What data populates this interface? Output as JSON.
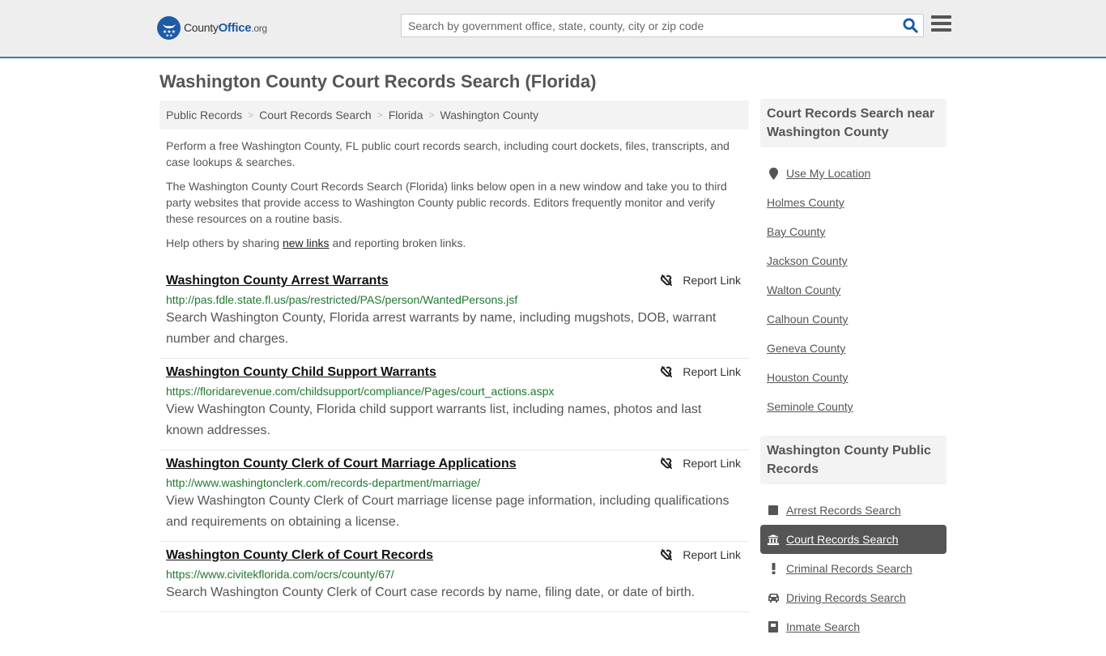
{
  "header": {
    "logo": {
      "name_part1": "County",
      "name_part2": "Office",
      "name_part3": ".org"
    },
    "search": {
      "placeholder": "Search by government office, state, county, city or zip code",
      "value": ""
    },
    "icons": {
      "search": "search-icon",
      "menu": "hamburger-menu-icon"
    }
  },
  "page": {
    "title": "Washington County Court Records Search (Florida)"
  },
  "breadcrumb": [
    {
      "label": "Public Records"
    },
    {
      "label": "Court Records Search"
    },
    {
      "label": "Florida"
    },
    {
      "label": "Washington County"
    }
  ],
  "intro": {
    "p1": "Perform a free Washington County, FL public court records search, including court dockets, files, transcripts, and case lookups & searches.",
    "p2": "The Washington County Court Records Search (Florida) links below open in a new window and take you to third party websites that provide access to Washington County public records. Editors frequently monitor and verify these resources on a routine basis.",
    "p3_before": "Help others by sharing ",
    "p3_link": "new links",
    "p3_after": " and reporting broken links."
  },
  "results": [
    {
      "title": "Washington County Arrest Warrants",
      "url": "http://pas.fdle.state.fl.us/pas/restricted/PAS/person/WantedPersons.jsf",
      "description": "Search Washington County, Florida arrest warrants by name, including mugshots, DOB, warrant number and charges.",
      "report_label": "Report Link"
    },
    {
      "title": "Washington County Child Support Warrants",
      "url": "https://floridarevenue.com/childsupport/compliance/Pages/court_actions.aspx",
      "description": "View Washington County, Florida child support warrants list, including names, photos and last known addresses.",
      "report_label": "Report Link"
    },
    {
      "title": "Washington County Clerk of Court Marriage Applications",
      "url": "http://www.washingtonclerk.com/records-department/marriage/",
      "description": "View Washington County Clerk of Court marriage license page information, including qualifications and requirements on obtaining a license.",
      "report_label": "Report Link"
    },
    {
      "title": "Washington County Clerk of Court Records",
      "url": "https://www.civitekflorida.com/ocrs/county/67/",
      "description": "Search Washington County Clerk of Court case records by name, filing date, or date of birth.",
      "report_label": "Report Link"
    }
  ],
  "sidebar": {
    "nearby_heading": "Court Records Search near Washington County",
    "use_location": "Use My Location",
    "nearby": [
      {
        "label": "Holmes County"
      },
      {
        "label": "Bay County"
      },
      {
        "label": "Jackson County"
      },
      {
        "label": "Walton County"
      },
      {
        "label": "Calhoun County"
      },
      {
        "label": "Geneva County"
      },
      {
        "label": "Houston County"
      },
      {
        "label": "Seminole County"
      }
    ],
    "public_heading": "Washington County Public Records",
    "public_records": [
      {
        "label": "Arrest Records Search",
        "icon": "square-icon",
        "active": false
      },
      {
        "label": "Court Records Search",
        "icon": "courthouse-icon",
        "active": true
      },
      {
        "label": "Criminal Records Search",
        "icon": "exclamation-icon",
        "active": false
      },
      {
        "label": "Driving Records Search",
        "icon": "car-icon",
        "active": false
      },
      {
        "label": "Inmate Search",
        "icon": "inmate-icon",
        "active": false
      }
    ]
  },
  "colors": {
    "brand_blue": "#1d5ba6",
    "header_border": "#3a7bb8",
    "url_green": "#1e7a2e",
    "active_bg": "#555555"
  }
}
